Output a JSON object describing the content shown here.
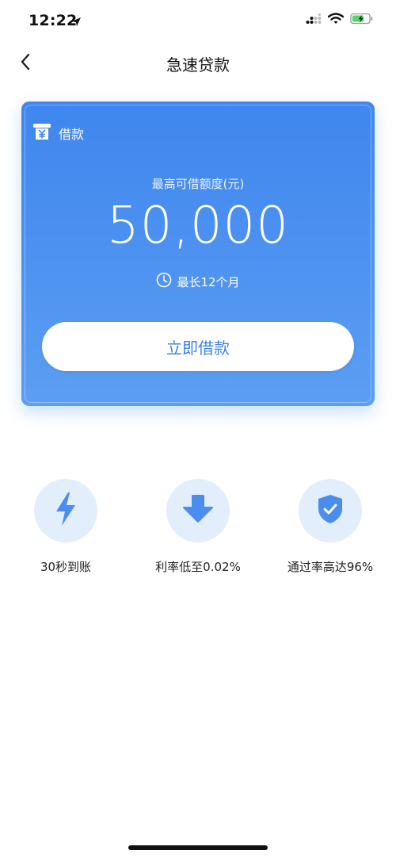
{
  "status_bar": {
    "time": "12:22",
    "icons": [
      "location-arrow-icon",
      "cellular-signal-icon",
      "wifi-icon",
      "battery-charging-icon"
    ]
  },
  "nav": {
    "title": "急速贷款",
    "back_icon": "chevron-left-icon"
  },
  "loan_card": {
    "header_label": "借款",
    "header_icon": "yuan-receipt-icon",
    "limit_label": "最高可借额度(元)",
    "limit_amount": "50,000",
    "term_text": "最长12个月",
    "term_icon": "clock-icon",
    "borrow_button": "立即借款"
  },
  "features": [
    {
      "icon": "lightning-icon",
      "label": "30秒到账"
    },
    {
      "icon": "down-arrow-icon",
      "label": "利率低至0.02%"
    },
    {
      "icon": "shield-check-icon",
      "label": "通过率高达96%"
    }
  ],
  "colors": {
    "primary": "#3b82ea",
    "feature_bg": "#e3eefc",
    "battery_green": "#4cd964"
  }
}
